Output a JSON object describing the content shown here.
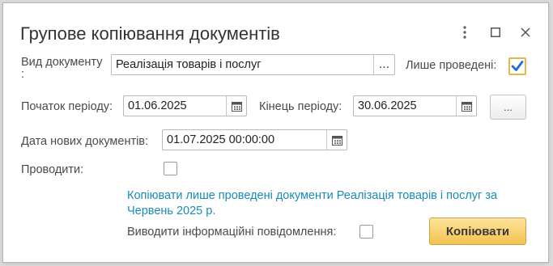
{
  "window": {
    "title": "Групове копіювання документів",
    "menu_icon": "more-vertical-icon",
    "maximize_icon": "maximize-icon",
    "close_icon": "close-icon"
  },
  "form": {
    "doc_type_label": "Вид документу",
    "doc_type_label_colon": ":",
    "doc_type_value": "Реалізація товарів і послуг",
    "select_button": "...",
    "only_posted_label": "Лише проведені:",
    "only_posted_checked": true,
    "period_start_label": "Початок періоду:",
    "period_start_value": "01.06.2025",
    "period_end_label": "Кінець періоду:",
    "period_end_value": "30.06.2025",
    "period_button": "...",
    "new_docs_date_label": "Дата нових документів:",
    "new_docs_date_value": "01.07.2025 00:00:00",
    "post_label": "Проводити:",
    "post_checked": false,
    "info_text": "Копіювати лише проведені документи Реалізація товарів і послуг за Червень 2025 р.",
    "show_messages_label": "Виводити інформаційні повідомлення:",
    "show_messages_checked": false,
    "copy_button": "Копіювати"
  },
  "colors": {
    "accent_check": "#1f6fd1",
    "link": "#1a8bb8",
    "primary_button": "#f3c24f"
  }
}
